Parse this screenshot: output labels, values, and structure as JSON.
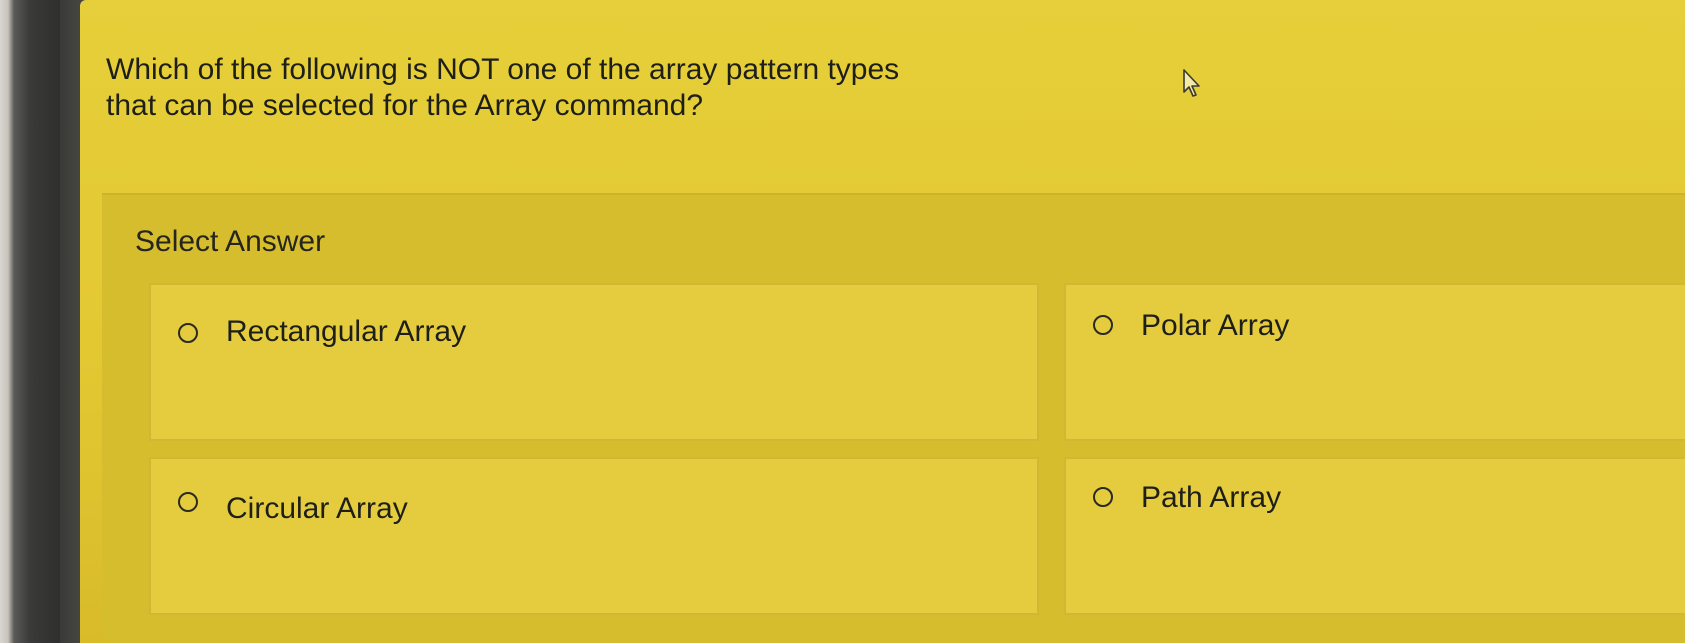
{
  "question": {
    "line1": "Which of the following is NOT one of the array pattern types",
    "line2": "that can be selected for the Array command?"
  },
  "answer_section": {
    "label": "Select Answer",
    "options": [
      {
        "label": "Rectangular Array",
        "selected": false
      },
      {
        "label": "Polar Array",
        "selected": false
      },
      {
        "label": "Circular Array",
        "selected": false
      },
      {
        "label": "Path Array",
        "selected": false
      }
    ]
  },
  "colors": {
    "page_background": "#e6cf3a",
    "answer_panel": "#d6bd2e",
    "option_background": "#e5cc3e",
    "text": "#1f1f1a"
  },
  "icons": {
    "cursor": "mouse-pointer-icon",
    "radio": "radio-button-unchecked-icon"
  }
}
